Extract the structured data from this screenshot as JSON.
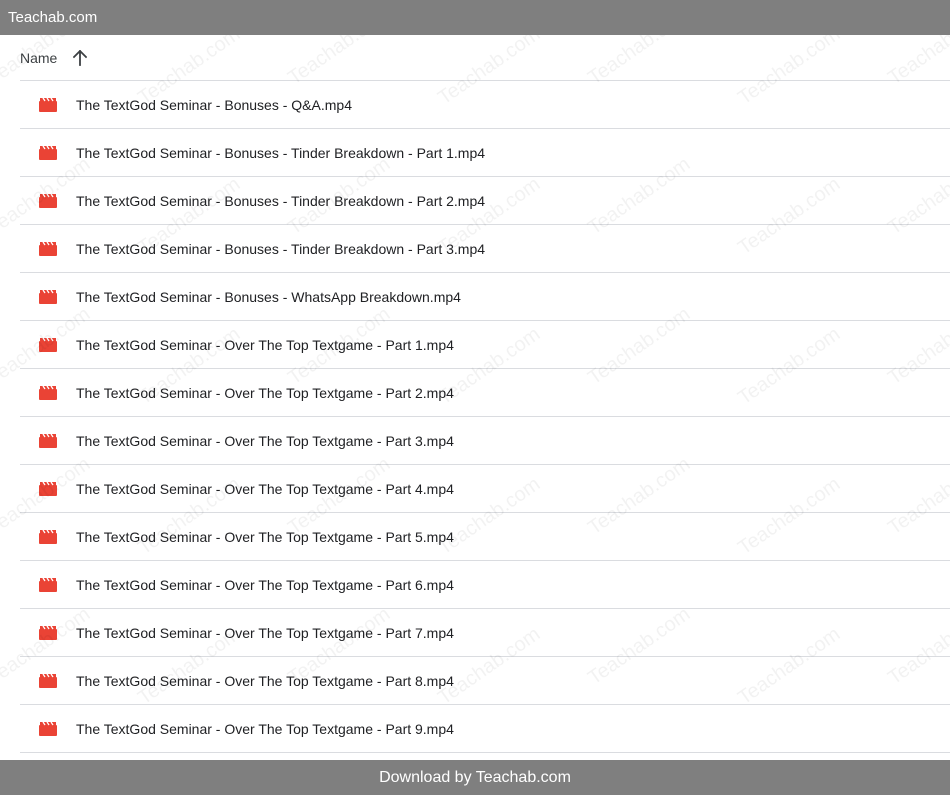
{
  "site": {
    "title": "Teachab.com",
    "watermark": "Teachab.com"
  },
  "header": {
    "name_label": "Name",
    "sort_icon": "arrow-up-icon"
  },
  "files": [
    {
      "name": "The TextGod Seminar - Bonuses - Q&A.mp4",
      "icon": "video-file-icon"
    },
    {
      "name": "The TextGod Seminar - Bonuses - Tinder Breakdown - Part 1.mp4",
      "icon": "video-file-icon"
    },
    {
      "name": "The TextGod Seminar - Bonuses - Tinder Breakdown - Part 2.mp4",
      "icon": "video-file-icon"
    },
    {
      "name": "The TextGod Seminar - Bonuses - Tinder Breakdown - Part 3.mp4",
      "icon": "video-file-icon"
    },
    {
      "name": "The TextGod Seminar - Bonuses - WhatsApp Breakdown.mp4",
      "icon": "video-file-icon"
    },
    {
      "name": "The TextGod Seminar - Over The Top Textgame - Part 1.mp4",
      "icon": "video-file-icon"
    },
    {
      "name": "The TextGod Seminar - Over The Top Textgame - Part 2.mp4",
      "icon": "video-file-icon"
    },
    {
      "name": "The TextGod Seminar - Over The Top Textgame - Part 3.mp4",
      "icon": "video-file-icon"
    },
    {
      "name": "The TextGod Seminar - Over The Top Textgame - Part 4.mp4",
      "icon": "video-file-icon"
    },
    {
      "name": "The TextGod Seminar - Over The Top Textgame - Part 5.mp4",
      "icon": "video-file-icon"
    },
    {
      "name": "The TextGod Seminar - Over The Top Textgame - Part 6.mp4",
      "icon": "video-file-icon"
    },
    {
      "name": "The TextGod Seminar - Over The Top Textgame - Part 7.mp4",
      "icon": "video-file-icon"
    },
    {
      "name": "The TextGod Seminar - Over The Top Textgame - Part 8.mp4",
      "icon": "video-file-icon"
    },
    {
      "name": "The TextGod Seminar - Over The Top Textgame - Part 9.mp4",
      "icon": "video-file-icon"
    }
  ],
  "footer": {
    "text": "Download by Teachab.com"
  },
  "colors": {
    "bar_background": "#7f7f7f",
    "video_icon": "#ea4335",
    "divider": "#dadce0"
  }
}
